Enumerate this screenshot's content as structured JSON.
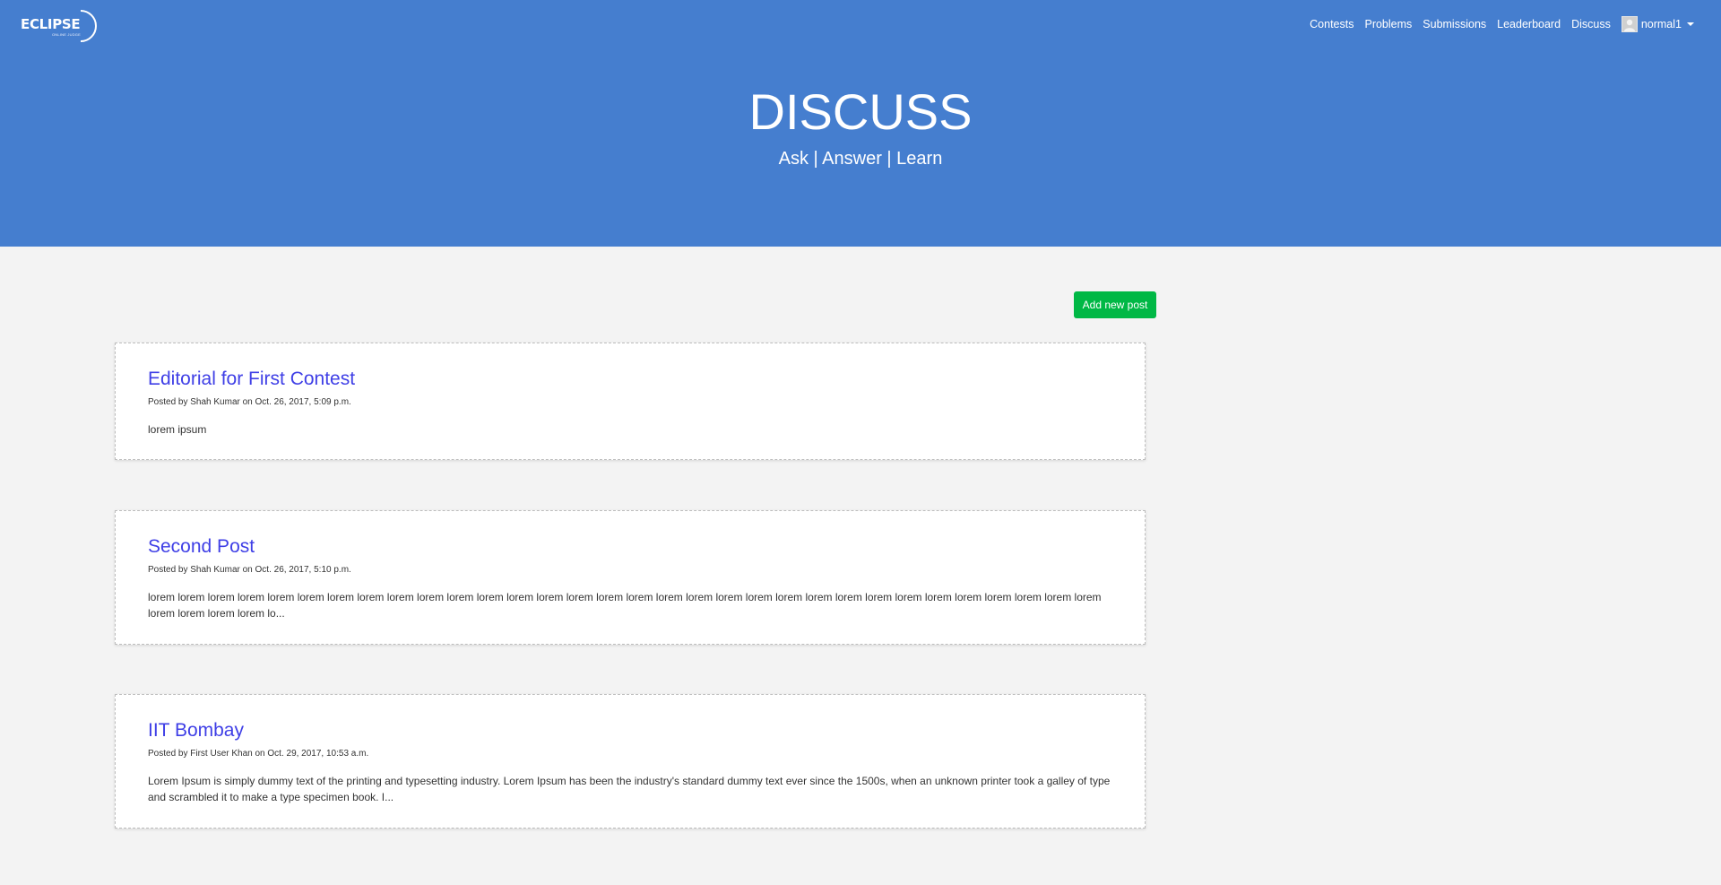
{
  "brand": {
    "name": "ECLIPSE",
    "tagline": "ONLINE JUDGE"
  },
  "nav": {
    "items": [
      "Contests",
      "Problems",
      "Submissions",
      "Leaderboard",
      "Discuss"
    ],
    "user": "normal1"
  },
  "hero": {
    "title": "DISCUSS",
    "subtitle": "Ask | Answer | Learn"
  },
  "actions": {
    "add_post": "Add new post"
  },
  "posts": [
    {
      "title": "Editorial for First Contest",
      "meta": "Posted by Shah Kumar on Oct. 26, 2017, 5:09 p.m.",
      "body": "lorem ipsum"
    },
    {
      "title": "Second Post",
      "meta": "Posted by Shah Kumar on Oct. 26, 2017, 5:10 p.m.",
      "body": "lorem lorem lorem lorem lorem lorem lorem lorem lorem lorem lorem lorem lorem lorem lorem lorem lorem lorem lorem lorem lorem lorem lorem lorem lorem lorem lorem lorem lorem lorem lorem lorem lorem lorem lorem lorem lo..."
    },
    {
      "title": "IIT Bombay",
      "meta": "Posted by First User Khan on Oct. 29, 2017, 10:53 a.m.",
      "body": "Lorem Ipsum is simply dummy text of the printing and typesetting industry. Lorem Ipsum has been the industry's standard dummy text ever since the 1500s, when an unknown printer took a galley of type and scrambled it to make a type specimen book. I..."
    }
  ],
  "colors": {
    "hero_bg": "#457ecf",
    "page_bg": "#f3f3f3",
    "add_button": "#00b845",
    "post_title": "#3f3fe6"
  },
  "icons": [
    "eclipse-logo",
    "user-avatar-icon",
    "caret-down-icon"
  ]
}
